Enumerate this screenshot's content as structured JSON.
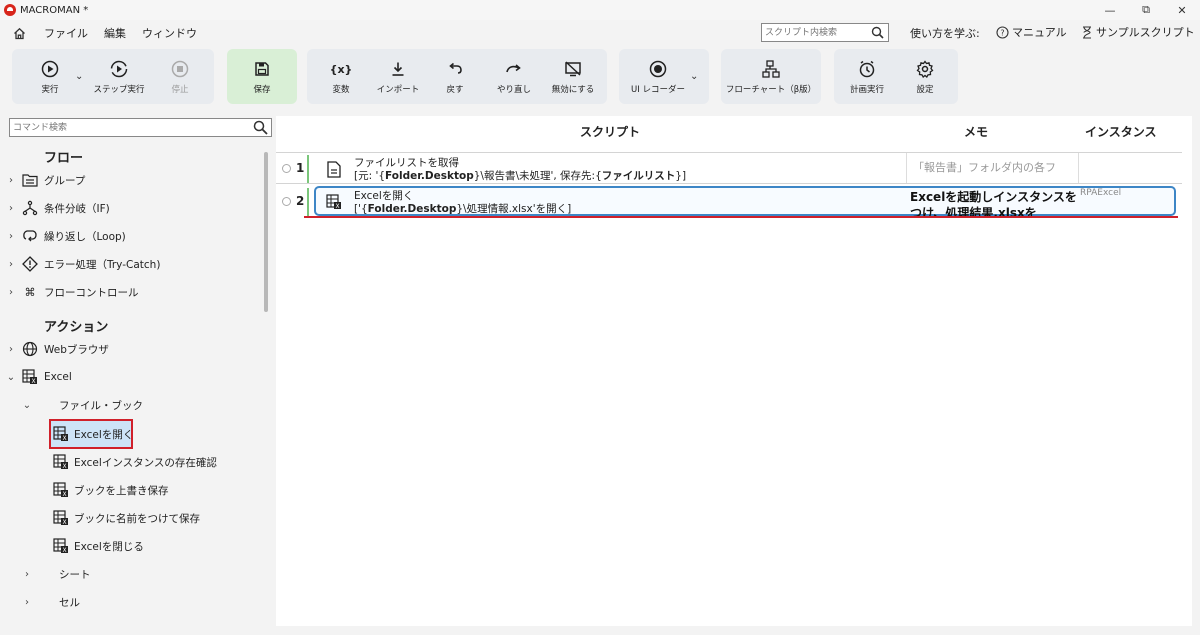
{
  "window": {
    "title": "MACROMAN *",
    "controls": {
      "minimize": "—",
      "restore": "⧉",
      "close": "✕"
    }
  },
  "menu": {
    "items": [
      "ファイル",
      "編集",
      "ウィンドウ"
    ],
    "script_search_placeholder": "スクリプト内検索",
    "learn_label": "使い方を学ぶ:",
    "manual_label": "マニュアル",
    "samples_label": "サンプルスクリプト"
  },
  "toolbar": {
    "run": "実行",
    "step_run": "ステップ実行",
    "stop": "停止",
    "save": "保存",
    "variables": "変数",
    "import": "インポート",
    "undo": "戻す",
    "redo": "やり直し",
    "disable": "無効にする",
    "ui_recorder": "UI レコーダー",
    "flowchart": "フローチャート（β版）",
    "scheduled_run": "計画実行",
    "settings": "設定",
    "variables_icon_text": "{x}"
  },
  "left_panel": {
    "command_search_placeholder": "コマンド検索",
    "flow_title": "フロー",
    "flow_items": [
      "グループ",
      "条件分岐（IF)",
      "繰り返し（Loop)",
      "エラー処理（Try-Catch)",
      "フローコントロール"
    ],
    "action_title": "アクション",
    "action_items": {
      "web_browser": "Webブラウザ",
      "excel": "Excel",
      "file_book": "ファイル・ブック",
      "excel_open": "Excelを開く",
      "excel_instance_check": "Excelインスタンスの存在確認",
      "book_overwrite_save": "ブックを上書き保存",
      "book_save_as": "ブックに名前をつけて保存",
      "excel_close": "Excelを閉じる",
      "sheet": "シート",
      "cell": "セル"
    }
  },
  "main": {
    "columns": {
      "script": "スクリプト",
      "memo": "メモ",
      "instance": "インスタンス"
    },
    "rows": [
      {
        "num": "1",
        "title": "ファイルリストを取得",
        "line2_pre": "[元: '{",
        "line2_bold1": "Folder.Desktop",
        "line2_mid": "}\\報告書\\未処理', 保存先:{",
        "line2_bold2": "ファイルリスト",
        "line2_post": "}]",
        "memo": "「報告書」フォルダ内の各フ",
        "instance": ""
      },
      {
        "num": "2",
        "title": "Excelを開く",
        "line2_pre": "['{",
        "line2_bold1": "Folder.Desktop",
        "line2_mid": "}\\処理情報.xlsx'を開く]",
        "memo": "Excelを起動しインスタンスをつけ、処理結果.xlsxを",
        "instance": "RPAExcel"
      }
    ]
  }
}
